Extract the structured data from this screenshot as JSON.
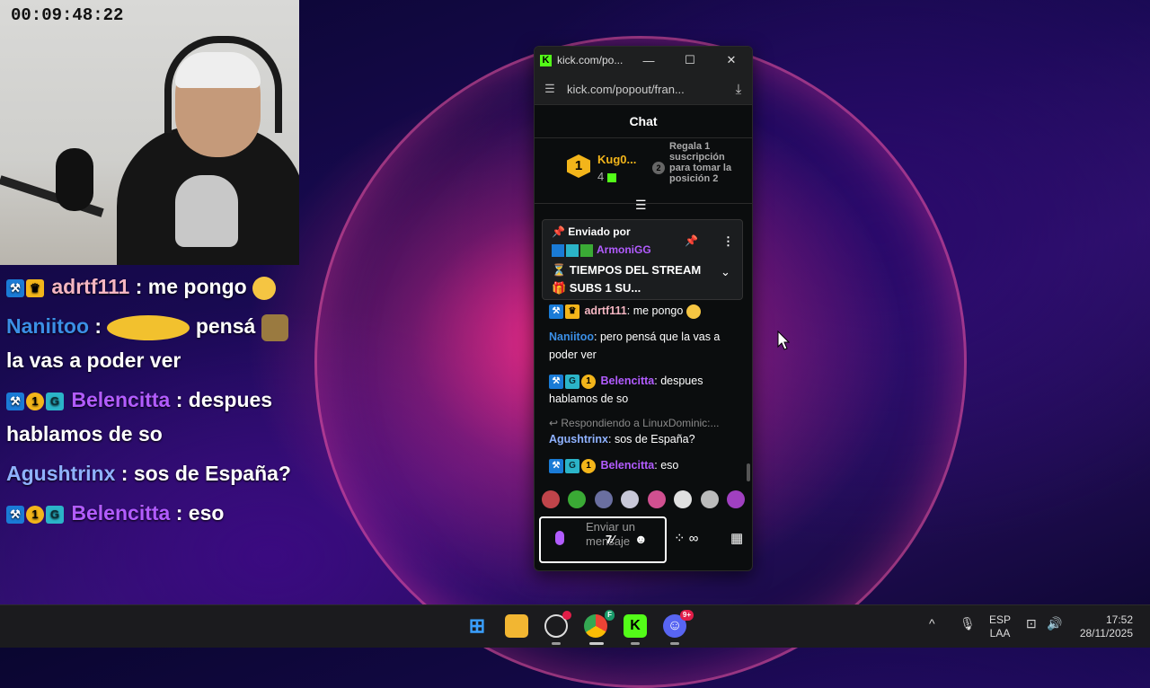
{
  "webcam": {
    "timer": "00:09:48:22"
  },
  "overlay_chat": [
    {
      "user": "adrtf111",
      "user_color": "#f4b6c2",
      "sep": " : ",
      "text": "me pongo",
      "badges": [
        "mod",
        "crown"
      ]
    },
    {
      "user": "Naniitoo",
      "user_color": "#3b8fe6",
      "sep": " : ",
      "text1": "pensá",
      "text2": "la vas a poder ver",
      "badges": []
    },
    {
      "user": "Belencitta",
      "user_color": "#b25cff",
      "sep": " : ",
      "text": "despues hablamos de so",
      "badges": [
        "mod",
        "one",
        "gg"
      ]
    },
    {
      "user": "Agushtrinx",
      "user_color": "#8fb2ff",
      "sep": " : ",
      "text": "sos de España?",
      "badges": []
    },
    {
      "user": "Belencitta",
      "user_color": "#b25cff",
      "sep": " : ",
      "text": "eso",
      "badges": [
        "mod",
        "one",
        "gg"
      ]
    }
  ],
  "window": {
    "tab_title": "kick.com/po...",
    "address": "kick.com/popout/fran...",
    "chat_title": "Chat",
    "leaderboard": {
      "rank": "1",
      "name": "Kug0...",
      "count": "4",
      "rank2": "2",
      "gift_text": "Regala 1 suscripción para tomar la posición 2"
    },
    "pinned": {
      "header": "Enviado por",
      "user": "ArmoniGG",
      "text": "⏳ TIEMPOS DEL STREAM 🎁 SUBS 1 SU..."
    },
    "messages": [
      {
        "user": "adrtf111",
        "color": "#f4b6c2",
        "text": "me pongo"
      },
      {
        "user": "Naniitoo",
        "color": "#3b8fe6",
        "text": "pero pensá que la vas a poder ver"
      },
      {
        "user": "Belencitta",
        "color": "#b25cff",
        "text": "despues hablamos de so"
      },
      {
        "reply": "Respondiendo a LinuxDominic:...",
        "user": "Agushtrinx",
        "color": "#8fb2ff",
        "text": "sos de España?"
      },
      {
        "user": "Belencitta",
        "color": "#b25cff",
        "text": "eso"
      }
    ],
    "input_placeholder": "Enviar un mensaje"
  },
  "taskbar": {
    "lang_top": "ESP",
    "lang_bottom": "LAA",
    "time": "17:52",
    "date": "28/11/2025",
    "chrome_badge": "F",
    "discord_badge": "9+"
  },
  "colors": {
    "kick_green": "#53fc18",
    "accent_purple": "#b25cff"
  }
}
